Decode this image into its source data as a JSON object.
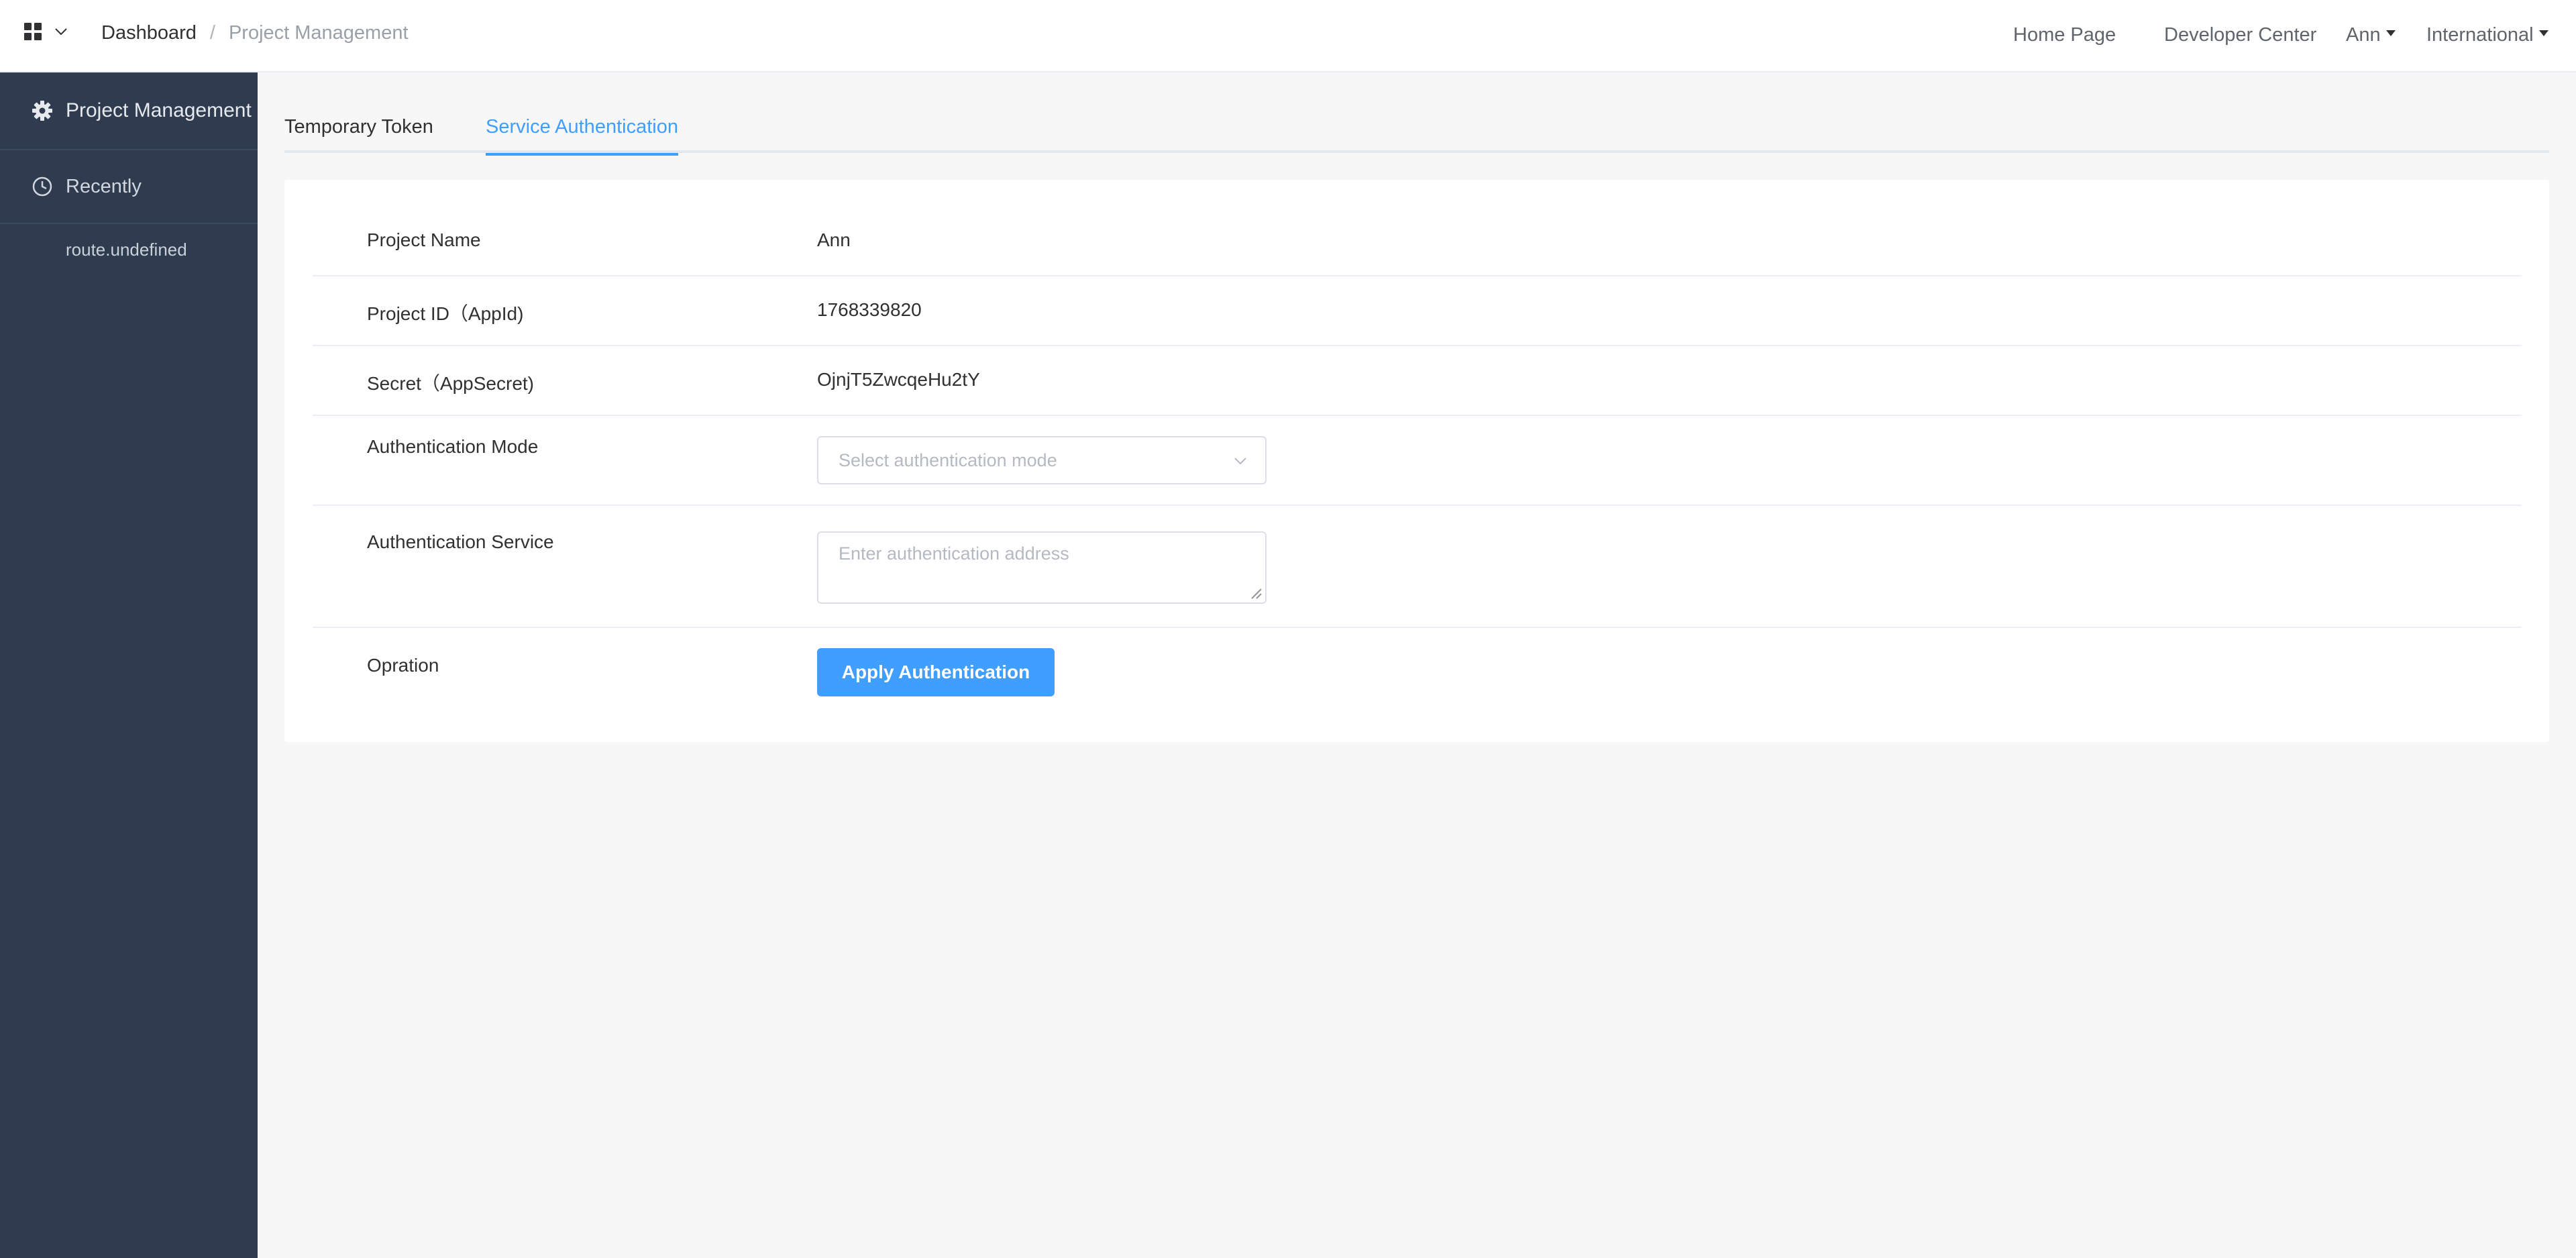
{
  "header": {
    "breadcrumb": {
      "root": "Dashboard",
      "separator": "/",
      "current": "Project Management"
    },
    "nav": {
      "home": "Home Page",
      "developer": "Developer Center",
      "user": "Ann",
      "region": "International"
    }
  },
  "sidebar": {
    "items": [
      {
        "label": "Project Management",
        "icon": "gear-icon"
      },
      {
        "label": "Recently",
        "icon": "clock-icon"
      }
    ],
    "recent_links": [
      {
        "label": "route.undefined"
      }
    ]
  },
  "tabs": [
    {
      "label": "Temporary Token",
      "active": false
    },
    {
      "label": "Service Authentication",
      "active": true
    }
  ],
  "form": {
    "project_name": {
      "label": "Project Name",
      "value": "Ann"
    },
    "project_id": {
      "label": "Project ID（AppId)",
      "value": "1768339820"
    },
    "secret": {
      "label": "Secret（AppSecret)",
      "value": "OjnjT5ZwcqeHu2tY"
    },
    "auth_mode": {
      "label": "Authentication Mode",
      "placeholder": "Select authentication mode",
      "value": ""
    },
    "auth_service": {
      "label": "Authentication Service",
      "placeholder": "Enter authentication address",
      "value": ""
    },
    "operation": {
      "label": "Opration",
      "button": "Apply Authentication"
    }
  },
  "colors": {
    "accent": "#409eff",
    "sidebar_bg": "#2f3b4e",
    "page_bg": "#f7f7f7"
  }
}
